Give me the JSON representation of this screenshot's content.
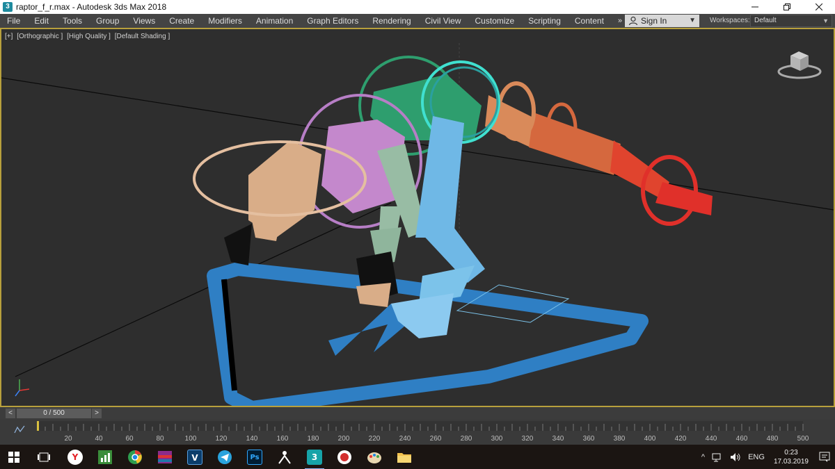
{
  "window": {
    "title": "raptor_f_r.max - Autodesk 3ds Max 2018",
    "app_icon": "3ds-max-icon",
    "controls": [
      "minimize-icon",
      "restore-icon",
      "close-icon"
    ]
  },
  "menubar": {
    "items": [
      "File",
      "Edit",
      "Tools",
      "Group",
      "Views",
      "Create",
      "Modifiers",
      "Animation",
      "Graph Editors",
      "Rendering",
      "Civil View",
      "Customize",
      "Scripting",
      "Content"
    ],
    "overflow": "»",
    "sign_in": "Sign In",
    "workspaces_label": "Workspaces:",
    "workspace_value": "Default"
  },
  "viewport": {
    "labels": [
      "[+]",
      "[Orthographic ]",
      "[High Quality ]",
      "[Default Shading ]"
    ],
    "viewcube_icon": "viewcube-icon",
    "colors": {
      "background": "#2e2e2e",
      "active_border": "#b8a03c",
      "tan": "#d9ad88",
      "pink": "#c488cc",
      "green": "#2e9e6e",
      "cyan": "#40e0d0",
      "sky": "#6fb8e6",
      "sage": "#98bca4",
      "orange": "#d98a5a",
      "red": "#e0302a",
      "blue": "#2f7fc4"
    }
  },
  "timeline": {
    "slider_label": "0 / 500",
    "prev": "<",
    "next": ">",
    "ticks": [
      "20",
      "40",
      "60",
      "80",
      "100",
      "120",
      "140",
      "160",
      "180",
      "200",
      "220",
      "240",
      "260",
      "280",
      "300",
      "320",
      "340",
      "360",
      "380",
      "400",
      "420",
      "440",
      "460",
      "480",
      "500"
    ]
  },
  "taskbar": {
    "apps": [
      {
        "name": "start",
        "icon": "windows-icon"
      },
      {
        "name": "task-view",
        "icon": "task-view-icon"
      },
      {
        "name": "yandex",
        "icon": "yandex-browser-icon",
        "label": "Y"
      },
      {
        "name": "charts",
        "icon": "chart-app-icon"
      },
      {
        "name": "chrome",
        "icon": "chrome-icon"
      },
      {
        "name": "archive",
        "icon": "winrar-icon"
      },
      {
        "name": "vegas",
        "icon": "v-app-icon",
        "label": "V"
      },
      {
        "name": "telegram",
        "icon": "telegram-icon"
      },
      {
        "name": "photoshop",
        "icon": "photoshop-icon",
        "label": "Ps"
      },
      {
        "name": "zbrush",
        "icon": "zbrush-icon"
      },
      {
        "name": "3dsmax",
        "icon": "3ds-max-icon",
        "label": "3"
      },
      {
        "name": "recorder",
        "icon": "record-icon"
      },
      {
        "name": "paint",
        "icon": "paint-icon"
      },
      {
        "name": "explorer",
        "icon": "folder-icon"
      }
    ],
    "tray": {
      "chevron": "^",
      "lang": "ENG",
      "time": "0:23",
      "date": "17.03.2019"
    }
  }
}
